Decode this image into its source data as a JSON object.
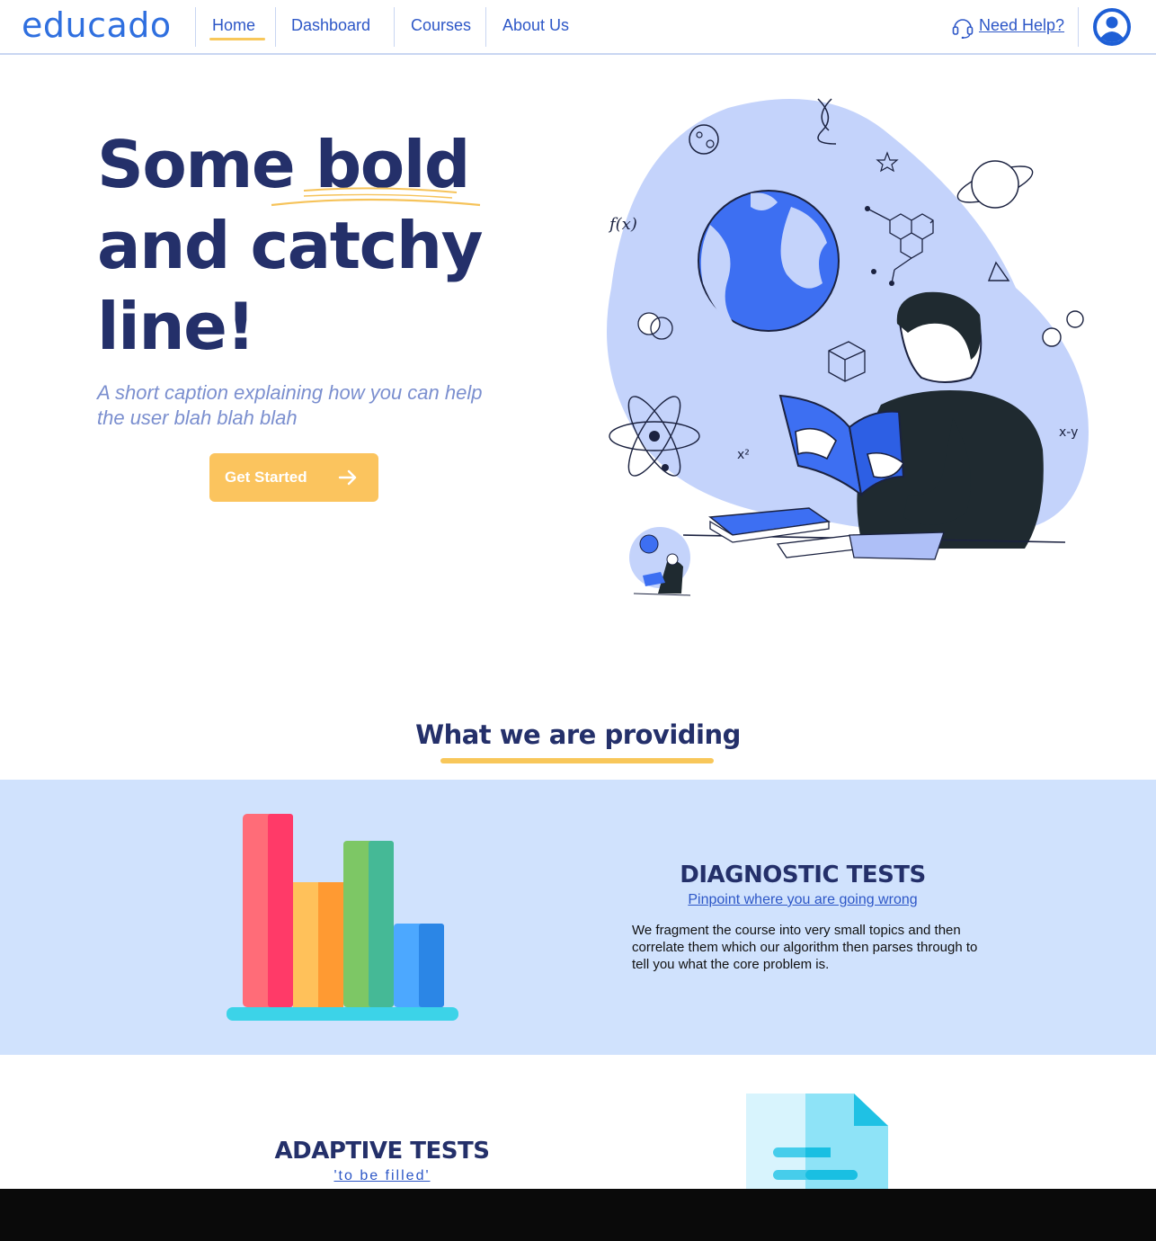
{
  "nav": {
    "logo": "educado",
    "links": [
      {
        "label": "Home",
        "active": true
      },
      {
        "label": "Dashboard"
      },
      {
        "label": "Courses"
      },
      {
        "label": "About Us"
      }
    ],
    "help_label": "Need Help?",
    "help_icon": "headset-icon",
    "avatar_icon": "user-avatar-icon"
  },
  "hero": {
    "title_lines": [
      "Some bold",
      "and catchy",
      "line!"
    ],
    "caption": "A short caption explaining how you can help the user blah blah blah",
    "cta_label": "Get Started",
    "cta_icon": "arrow-right-icon"
  },
  "provide": {
    "title": "What we are providing",
    "diagnostic": {
      "heading": "DIAGNOSTIC TESTS",
      "subheading": "Pinpoint where you are going wrong",
      "body": "We fragment the course into very small topics and then correlate them which our algorithm then parses through to tell you what the core problem is."
    },
    "adaptive": {
      "heading": "ADAPTIVE TESTS",
      "subheading": "'to be filled'"
    }
  },
  "colors": {
    "brand_blue": "#2f6fdf",
    "navy": "#24306a",
    "accent_yellow": "#fbc45e",
    "band_blue": "#d0e2fd"
  }
}
